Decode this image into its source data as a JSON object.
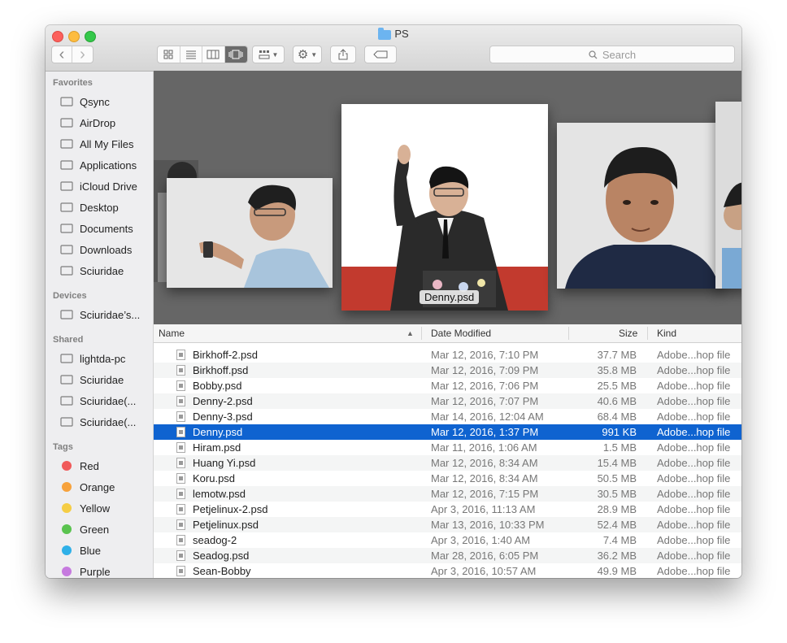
{
  "window": {
    "title": "PS"
  },
  "toolbar": {
    "back": "‹",
    "forward": "›",
    "search_placeholder": "Search"
  },
  "sidebar": {
    "favorites_header": "Favorites",
    "favorites": [
      {
        "label": "Qsync",
        "icon": "folder-icon"
      },
      {
        "label": "AirDrop",
        "icon": "airdrop-icon"
      },
      {
        "label": "All My Files",
        "icon": "all-files-icon"
      },
      {
        "label": "Applications",
        "icon": "applications-icon"
      },
      {
        "label": "iCloud Drive",
        "icon": "cloud-icon"
      },
      {
        "label": "Desktop",
        "icon": "desktop-icon"
      },
      {
        "label": "Documents",
        "icon": "documents-icon"
      },
      {
        "label": "Downloads",
        "icon": "downloads-icon"
      },
      {
        "label": "Sciuridae",
        "icon": "home-icon"
      }
    ],
    "devices_header": "Devices",
    "devices": [
      {
        "label": "Sciuridae’s...",
        "icon": "laptop-icon"
      }
    ],
    "shared_header": "Shared",
    "shared": [
      {
        "label": "lightda-pc",
        "icon": "pc-icon"
      },
      {
        "label": "Sciuridae",
        "icon": "display-icon"
      },
      {
        "label": "Sciuridae(...",
        "icon": "nas-icon"
      },
      {
        "label": "Sciuridae(...",
        "icon": "nas-icon"
      }
    ],
    "tags_header": "Tags",
    "tags": [
      {
        "label": "Red",
        "color": "#f05a5a"
      },
      {
        "label": "Orange",
        "color": "#f7a23c"
      },
      {
        "label": "Yellow",
        "color": "#f5cd45"
      },
      {
        "label": "Green",
        "color": "#5ac34f"
      },
      {
        "label": "Blue",
        "color": "#2fb0e8"
      },
      {
        "label": "Purple",
        "color": "#c67adf"
      }
    ]
  },
  "coverflow": {
    "caption": "Denny.psd"
  },
  "columns": {
    "name": "Name",
    "date": "Date Modified",
    "size": "Size",
    "kind": "Kind"
  },
  "files": [
    {
      "name": "Birkhoff-2.psd",
      "date": "Mar 12, 2016, 7:10 PM",
      "size": "37.7 MB",
      "kind": "Adobe...hop file"
    },
    {
      "name": "Birkhoff.psd",
      "date": "Mar 12, 2016, 7:09 PM",
      "size": "35.8 MB",
      "kind": "Adobe...hop file"
    },
    {
      "name": "Bobby.psd",
      "date": "Mar 12, 2016, 7:06 PM",
      "size": "25.5 MB",
      "kind": "Adobe...hop file"
    },
    {
      "name": "Denny-2.psd",
      "date": "Mar 12, 2016, 7:07 PM",
      "size": "40.6 MB",
      "kind": "Adobe...hop file"
    },
    {
      "name": "Denny-3.psd",
      "date": "Mar 14, 2016, 12:04 AM",
      "size": "68.4 MB",
      "kind": "Adobe...hop file"
    },
    {
      "name": "Denny.psd",
      "date": "Mar 12, 2016, 1:37 PM",
      "size": "991 KB",
      "kind": "Adobe...hop file",
      "selected": true
    },
    {
      "name": "Hiram.psd",
      "date": "Mar 11, 2016, 1:06 AM",
      "size": "1.5 MB",
      "kind": "Adobe...hop file"
    },
    {
      "name": "Huang Yi.psd",
      "date": "Mar 12, 2016, 8:34 AM",
      "size": "15.4 MB",
      "kind": "Adobe...hop file"
    },
    {
      "name": "Koru.psd",
      "date": "Mar 12, 2016, 8:34 AM",
      "size": "50.5 MB",
      "kind": "Adobe...hop file"
    },
    {
      "name": "lemotw.psd",
      "date": "Mar 12, 2016, 7:15 PM",
      "size": "30.5 MB",
      "kind": "Adobe...hop file"
    },
    {
      "name": "Petjelinux-2.psd",
      "date": "Apr 3, 2016, 11:13 AM",
      "size": "28.9 MB",
      "kind": "Adobe...hop file"
    },
    {
      "name": "Petjelinux.psd",
      "date": "Mar 13, 2016, 10:33 PM",
      "size": "52.4 MB",
      "kind": "Adobe...hop file"
    },
    {
      "name": "seadog-2",
      "date": "Apr 3, 2016, 1:40 AM",
      "size": "7.4 MB",
      "kind": "Adobe...hop file"
    },
    {
      "name": "Seadog.psd",
      "date": "Mar 28, 2016, 6:05 PM",
      "size": "36.2 MB",
      "kind": "Adobe...hop file"
    },
    {
      "name": "Sean-Bobby",
      "date": "Apr 3, 2016, 10:57 AM",
      "size": "49.9 MB",
      "kind": "Adobe...hop file"
    }
  ]
}
